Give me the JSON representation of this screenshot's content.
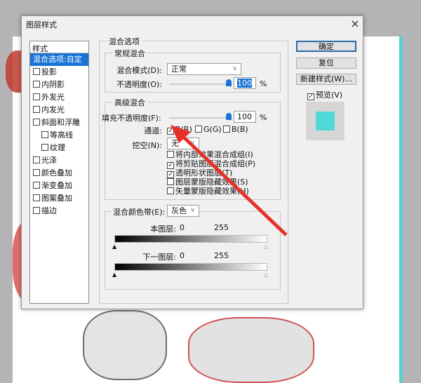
{
  "dialog": {
    "title": "图层样式",
    "close": "×"
  },
  "styles_list": {
    "header": "样式",
    "items": [
      {
        "label": "混合选项:自定",
        "selected": true,
        "checkbox": false,
        "sub": false
      },
      {
        "label": "投影",
        "checkbox": true,
        "sub": false
      },
      {
        "label": "内阴影",
        "checkbox": true,
        "sub": false
      },
      {
        "label": "外发光",
        "checkbox": true,
        "sub": false
      },
      {
        "label": "内发光",
        "checkbox": true,
        "sub": false
      },
      {
        "label": "斜面和浮雕",
        "checkbox": true,
        "sub": false
      },
      {
        "label": "等高线",
        "checkbox": true,
        "sub": true
      },
      {
        "label": "纹理",
        "checkbox": true,
        "sub": true
      },
      {
        "label": "光泽",
        "checkbox": true,
        "sub": false
      },
      {
        "label": "颜色叠加",
        "checkbox": true,
        "sub": false
      },
      {
        "label": "渐变叠加",
        "checkbox": true,
        "sub": false
      },
      {
        "label": "图案叠加",
        "checkbox": true,
        "sub": false
      },
      {
        "label": "描边",
        "checkbox": true,
        "sub": false
      }
    ]
  },
  "blend": {
    "title": "混合选项",
    "general": {
      "title": "常规混合",
      "mode_label": "混合模式(D):",
      "mode_value": "正常",
      "opacity_label": "不透明度(O):",
      "opacity_value": "100",
      "percent": "%"
    },
    "advanced": {
      "title": "高级混合",
      "fill_label": "填充不透明度(F):",
      "fill_value": "100",
      "percent": "%",
      "channels_label": "通道:",
      "channel_r": "R(R)",
      "channel_g": "G(G)",
      "channel_b": "B(B)",
      "knockout_label": "挖空(N):",
      "knockout_value": "无",
      "options": [
        {
          "label": "将内部效果混合成组(I)",
          "checked": false
        },
        {
          "label": "将剪贴图层混合成组(P)",
          "checked": true
        },
        {
          "label": "透明形状图层(T)",
          "checked": true
        },
        {
          "label": "图层蒙版隐藏效果(S)",
          "checked": false
        },
        {
          "label": "矢量蒙版隐藏效果(H)",
          "checked": false
        }
      ]
    },
    "blend_if": {
      "label": "混合颜色带(E):",
      "value": "灰色",
      "this_layer": "本图层:",
      "this_min": "0",
      "this_max": "255",
      "under_layer": "下一图层:",
      "under_min": "0",
      "under_max": "255"
    }
  },
  "buttons": {
    "ok": "确定",
    "reset": "复位",
    "new_style": "新建样式(W)...",
    "preview": "预览(V)",
    "preview_checked": true
  },
  "colors": {
    "accent": "#1a74d6",
    "preview_swatch": "#4fd8d8",
    "arrow": "#e8302a"
  }
}
